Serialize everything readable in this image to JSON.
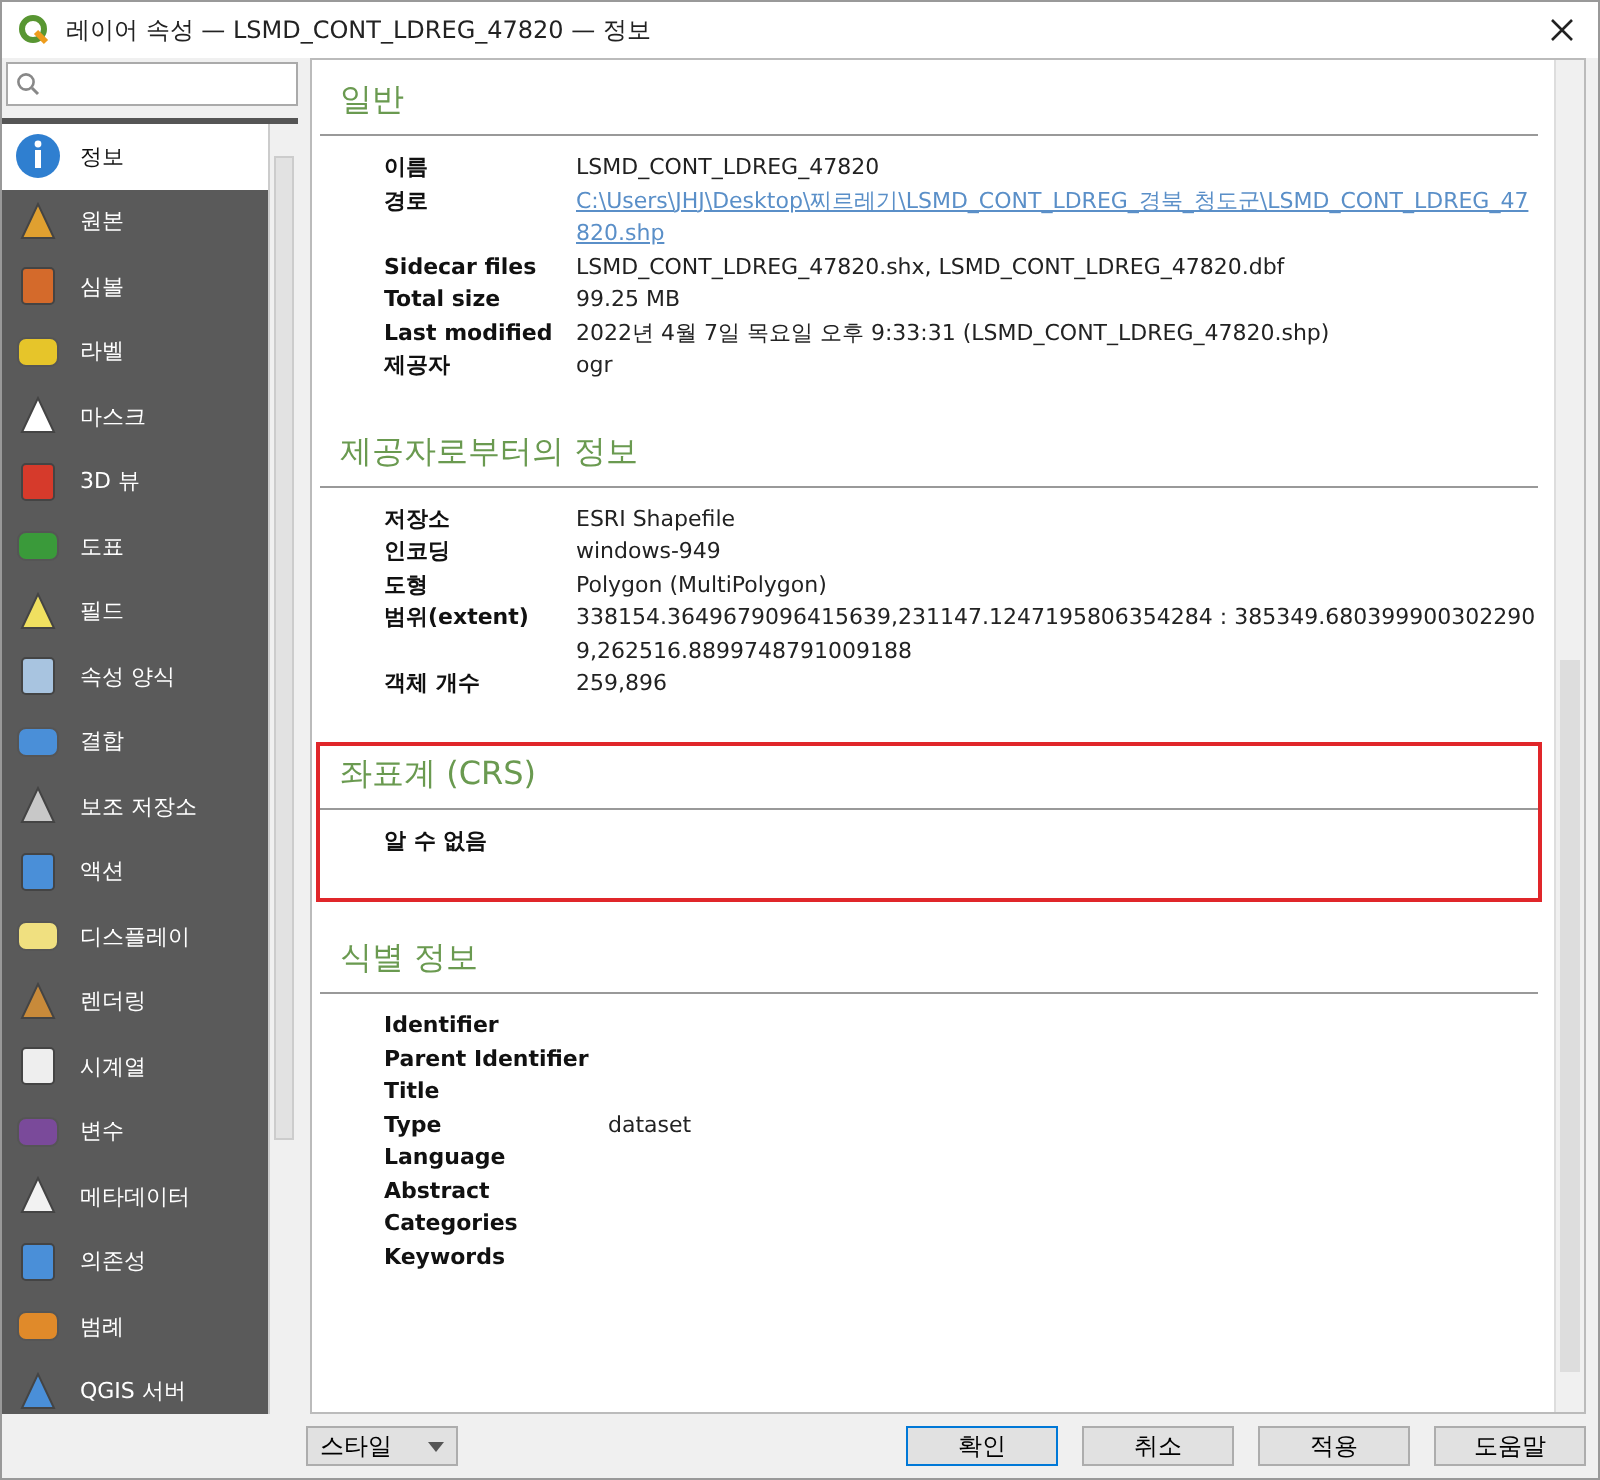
{
  "window": {
    "title": "레이어 속성 — LSMD_CONT_LDREG_47820 — 정보"
  },
  "sidebar": {
    "items": [
      {
        "label": "정보",
        "selected": true
      },
      {
        "label": "원본",
        "selected": false
      },
      {
        "label": "심볼",
        "selected": false
      },
      {
        "label": "라벨",
        "selected": false
      },
      {
        "label": "마스크",
        "selected": false
      },
      {
        "label": "3D 뷰",
        "selected": false
      },
      {
        "label": "도표",
        "selected": false
      },
      {
        "label": "필드",
        "selected": false
      },
      {
        "label": "속성 양식",
        "selected": false
      },
      {
        "label": "결합",
        "selected": false
      },
      {
        "label": "보조 저장소",
        "selected": false
      },
      {
        "label": "액션",
        "selected": false
      },
      {
        "label": "디스플레이",
        "selected": false
      },
      {
        "label": "렌더링",
        "selected": false
      },
      {
        "label": "시계열",
        "selected": false
      },
      {
        "label": "변수",
        "selected": false
      },
      {
        "label": "메타데이터",
        "selected": false
      },
      {
        "label": "의존성",
        "selected": false
      },
      {
        "label": "범례",
        "selected": false
      },
      {
        "label": "QGIS 서버",
        "selected": false
      }
    ]
  },
  "sections": [
    {
      "title": "일반",
      "highlighted": false,
      "rows": [
        {
          "label": "이름",
          "value": "LSMD_CONT_LDREG_47820"
        },
        {
          "label": "경로",
          "value": "C:\\Users\\JHJ\\Desktop\\찌르레기\\LSMD_CONT_LDREG_경북_청도군\\LSMD_CONT_LDREG_47820.shp",
          "kind": "link"
        },
        {
          "label": "Sidecar files",
          "value": "LSMD_CONT_LDREG_47820.shx, LSMD_CONT_LDREG_47820.dbf"
        },
        {
          "label": "Total size",
          "value": "99.25 MB"
        },
        {
          "label": "Last modified",
          "value": "2022년 4월 7일 목요일 오후 9:33:31 (LSMD_CONT_LDREG_47820.shp)"
        },
        {
          "label": "제공자",
          "value": "ogr"
        }
      ]
    },
    {
      "title": "제공자로부터의 정보",
      "highlighted": false,
      "rows": [
        {
          "label": "저장소",
          "value": "ESRI Shapefile"
        },
        {
          "label": "인코딩",
          "value": "windows-949"
        },
        {
          "label": "도형",
          "value": "Polygon (MultiPolygon)"
        },
        {
          "label": "범위(extent)",
          "value": "338154.3649679096415639,231147.1247195806354284 : 385349.6803999003022909,262516.8899748791009188"
        },
        {
          "label": "객체 개수",
          "value": "259,896"
        }
      ]
    },
    {
      "title": "좌표계 (CRS)",
      "highlighted": true,
      "rows": [
        {
          "label": "알 수 없음"
        }
      ]
    },
    {
      "title": "식별 정보",
      "highlighted": false,
      "rows": [
        {
          "label": "Identifier"
        },
        {
          "label": "Parent Identifier"
        },
        {
          "label": "Title"
        },
        {
          "label": "Type",
          "value": "dataset"
        },
        {
          "label": "Language"
        },
        {
          "label": "Abstract"
        },
        {
          "label": "Categories"
        },
        {
          "label": "Keywords"
        }
      ]
    }
  ],
  "style_button": {
    "label": "스타일"
  },
  "buttons": [
    {
      "label": "확인",
      "kind": "default"
    },
    {
      "label": "취소",
      "kind": "normal"
    },
    {
      "label": "적용",
      "kind": "normal"
    },
    {
      "label": "도움말",
      "kind": "normal"
    }
  ]
}
